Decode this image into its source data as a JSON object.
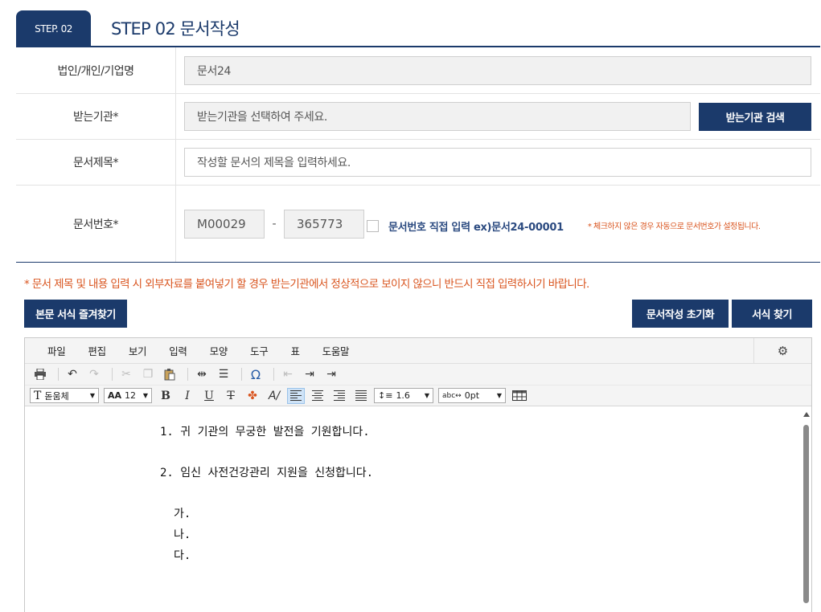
{
  "step": {
    "tab_label": "STEP. 02",
    "title": "STEP 02 문서작성"
  },
  "form": {
    "company": {
      "label": "법인/개인/기업명",
      "value": "문서24"
    },
    "recipient": {
      "label": "받는기관*",
      "placeholder": "받는기관을 선택하여 주세요.",
      "button": "받는기관 검색"
    },
    "subject": {
      "label": "문서제목*",
      "placeholder": "작성할 문서의 제목을 입력하세요."
    },
    "doc_number": {
      "label": "문서번호*",
      "prefix": "M00029",
      "dash": "-",
      "number": "365773",
      "manual_checkbox_label": "문서번호 직접 입력 ex)문서24-00001",
      "manual_note": "* 체크하지 않은 경우 자동으로 문서번호가 설정됩니다.",
      "manual_checked": false
    }
  },
  "notice": "* 문서 제목 및 내용 입력 시 외부자료를 붙여넣기 할 경우 받는기관에서 정상적으로 보이지 않으니 반드시 직접 입력하시기 바랍니다.",
  "buttons": {
    "favorites": "본문 서식 즐겨찾기",
    "reset": "문서작성 초기화",
    "find_template": "서식 찾기"
  },
  "editor": {
    "menu": [
      "파일",
      "편집",
      "보기",
      "입력",
      "모양",
      "도구",
      "표",
      "도움말"
    ],
    "toolbar": {
      "font": "돋움체",
      "font_size": "12",
      "line_height": "1.6",
      "letter_spacing": "0pt"
    },
    "content": [
      "1. 귀 기관의 무궁한 발전을 기원합니다.",
      "2. 임신 사전건강관리 지원을 신청합니다.",
      "가.",
      "나.",
      "다."
    ]
  },
  "colors": {
    "navy": "#1b3a6b",
    "notice": "#d9541e"
  }
}
